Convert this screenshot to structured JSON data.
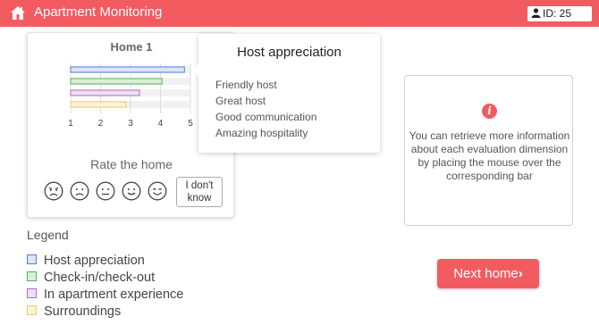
{
  "header": {
    "title": "Apartment Monitoring",
    "home_icon": "home-icon",
    "id_label": "ID: 25",
    "id_icon": "person-icon",
    "color": "#f25c60"
  },
  "home_card": {
    "title": "Home 1",
    "rate_label": "Rate the home",
    "faces": [
      "very-sad-face-icon",
      "sad-face-icon",
      "neutral-face-icon",
      "smile-face-icon",
      "happy-face-icon"
    ],
    "dont_know_line1": "I don't",
    "dont_know_line2": "know"
  },
  "chart_data": {
    "type": "bar",
    "orientation": "horizontal",
    "categories": [
      "Host appreciation",
      "Check-in/check-out",
      "In apartment experience",
      "Surroundings"
    ],
    "values": [
      4.8,
      4.05,
      3.3,
      2.85
    ],
    "ticks": [
      "1",
      "2",
      "3",
      "4",
      "5"
    ],
    "xlim": [
      1,
      5
    ],
    "colors": [
      "#4f7fd8",
      "#56b35b",
      "#b06cc4",
      "#f1c96a"
    ],
    "fills": [
      "#dbe6f8",
      "#d9efd9",
      "#efdff3",
      "#fdf3d9"
    ]
  },
  "tooltip": {
    "title": "Host appreciation",
    "items": [
      "Friendly host",
      "Great host",
      "Good communication",
      "Amazing hospitality"
    ]
  },
  "legend": {
    "title": "Legend",
    "items": [
      {
        "label": "Host appreciation",
        "color": "#4f7fd8",
        "fill": "#dbe6f8"
      },
      {
        "label": "Check-in/check-out",
        "color": "#56b35b",
        "fill": "#d9efd9"
      },
      {
        "label": "In apartment experience",
        "color": "#b06cc4",
        "fill": "#efdff3"
      },
      {
        "label": "Surroundings",
        "color": "#f1c96a",
        "fill": "#fdf3d9"
      }
    ]
  },
  "info": {
    "icon": "info-icon",
    "icon_glyph": "i",
    "text": "You can retrieve more information about each evaluation dimension by placing the mouse over the corresponding bar"
  },
  "next_button": {
    "label": "Next home",
    "arrow": "›"
  }
}
